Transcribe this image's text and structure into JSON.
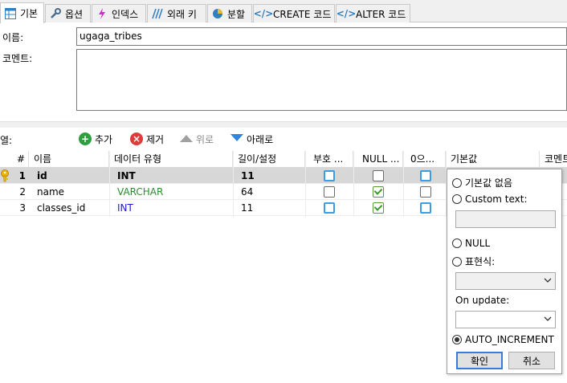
{
  "tabs": [
    {
      "label": "기본",
      "icon": "table-icon",
      "active": true
    },
    {
      "label": "옵션",
      "icon": "wrench-icon"
    },
    {
      "label": "인덱스",
      "icon": "lightning-icon"
    },
    {
      "label": "외래 키",
      "icon": "foreign-key-icon"
    },
    {
      "label": "분할",
      "icon": "pie-icon"
    },
    {
      "label": "CREATE 코드",
      "icon": "code-icon"
    },
    {
      "label": "ALTER 코드",
      "icon": "code-icon"
    }
  ],
  "form": {
    "name_label": "이름:",
    "name_value": "ugaga_tribes",
    "comment_label": "코멘트:"
  },
  "toolbar": {
    "columns_label": "열:",
    "add_label": "추가",
    "remove_label": "제거",
    "up_label": "위로",
    "down_label": "아래로"
  },
  "grid": {
    "headers": [
      "#",
      "이름",
      "데이터 유형",
      "길이/설정",
      "부호 ...",
      "NULL ...",
      "0으...",
      "기본값",
      "코멘트"
    ],
    "rows": [
      {
        "num": "1",
        "name": "id",
        "type": "INT",
        "length": "11"
      },
      {
        "num": "2",
        "name": "name",
        "type": "VARCHAR",
        "length": "64"
      },
      {
        "num": "3",
        "name": "classes_id",
        "type": "INT",
        "length": "11"
      }
    ]
  },
  "popup": {
    "no_default": "기본값 없음",
    "custom_text": "Custom text:",
    "null": "NULL",
    "expression": "표현식:",
    "on_update": "On update:",
    "auto_increment": "AUTO_INCREMENT",
    "ok": "확인",
    "cancel": "취소"
  },
  "colors": {
    "varchar": "#2e8b2e",
    "int": "#1a1ad0",
    "add": "#2e9e3e",
    "remove": "#e03a3a",
    "down": "#2e86de",
    "key": "#f0b400"
  }
}
